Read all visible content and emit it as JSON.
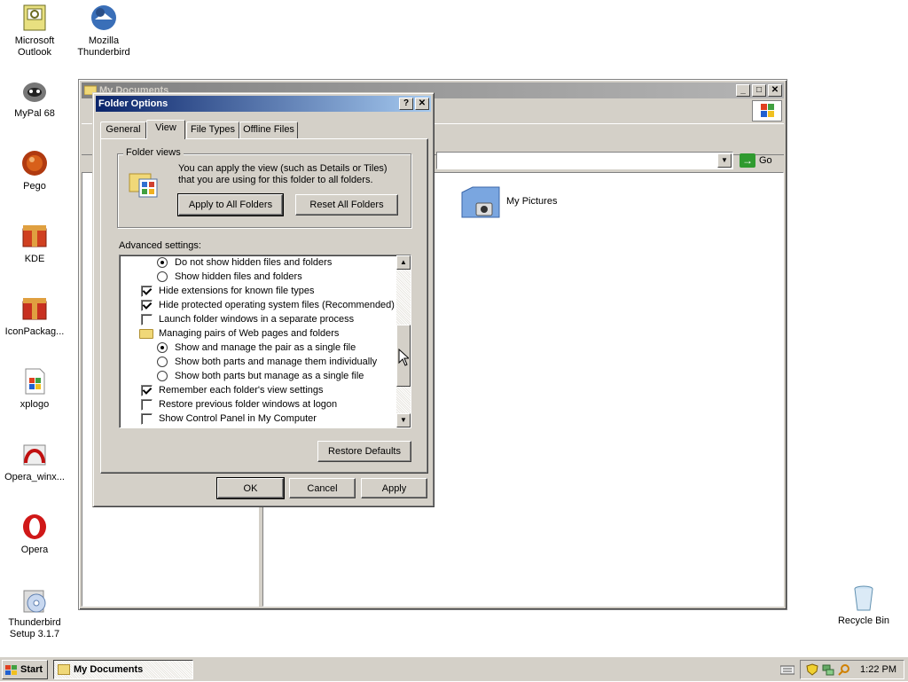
{
  "desktop": {
    "icons": [
      {
        "label": "Microsoft Outlook",
        "line1": "Microsoft",
        "line2": "Outlook",
        "icon": "outlook-icon"
      },
      {
        "label": "Mozilla Thunderbird",
        "line1": "Mozilla",
        "line2": "Thunderbird",
        "icon": "thunderbird-icon"
      },
      {
        "label": "MyPal 68",
        "icon": "mypal-icon"
      },
      {
        "label": "Pego",
        "icon": "pego-icon"
      },
      {
        "label": "KDE",
        "icon": "kde-icon"
      },
      {
        "label": "IconPackag...",
        "icon": "iconpackager-icon"
      },
      {
        "label": "xplogo",
        "icon": "xplogo-icon"
      },
      {
        "label": "Opera_winx...",
        "icon": "opera-installer-icon"
      },
      {
        "label": "Opera",
        "icon": "opera-icon"
      },
      {
        "label": "Thunderbird Setup 3.1.7",
        "line1": "Thunderbird",
        "line2": "Setup 3.1.7",
        "icon": "thunderbird-setup-icon"
      },
      {
        "label": "Recycle Bin",
        "icon": "recycle-bin-icon"
      }
    ]
  },
  "explorer": {
    "title": "My Documents",
    "go_label": "Go",
    "right_pane": {
      "item_label": "My Pictures"
    }
  },
  "dialog": {
    "title": "Folder Options",
    "help_glyph": "?",
    "close_glyph": "✕",
    "tabs": [
      "General",
      "View",
      "File Types",
      "Offline Files"
    ],
    "active_tab": "View",
    "folder_views": {
      "title": "Folder views",
      "text": "You can apply the view (such as Details or Tiles) that you are using for this folder to all folders.",
      "apply_all_label": "Apply to All Folders",
      "reset_all_label": "Reset All Folders"
    },
    "advanced_label": "Advanced settings:",
    "advanced_items": [
      {
        "type": "radio",
        "checked": true,
        "indent": 1,
        "label": "Do not show hidden files and folders"
      },
      {
        "type": "radio",
        "checked": false,
        "indent": 1,
        "label": "Show hidden files and folders"
      },
      {
        "type": "checkbox",
        "checked": true,
        "indent": 0,
        "label": "Hide extensions for known file types"
      },
      {
        "type": "checkbox",
        "checked": true,
        "indent": 0,
        "label": "Hide protected operating system files (Recommended)"
      },
      {
        "type": "checkbox",
        "checked": false,
        "indent": 0,
        "label": "Launch folder windows in a separate process"
      },
      {
        "type": "folder",
        "checked": false,
        "indent": 0,
        "label": "Managing pairs of Web pages and folders"
      },
      {
        "type": "radio",
        "checked": true,
        "indent": 1,
        "label": "Show and manage the pair as a single file"
      },
      {
        "type": "radio",
        "checked": false,
        "indent": 1,
        "label": "Show both parts and manage them individually"
      },
      {
        "type": "radio",
        "checked": false,
        "indent": 1,
        "label": "Show both parts but manage as a single file"
      },
      {
        "type": "checkbox",
        "checked": true,
        "indent": 0,
        "label": "Remember each folder's view settings"
      },
      {
        "type": "checkbox",
        "checked": false,
        "indent": 0,
        "label": "Restore previous folder windows at logon"
      },
      {
        "type": "checkbox",
        "checked": false,
        "indent": 0,
        "label": "Show Control Panel in My Computer"
      }
    ],
    "restore_defaults_label": "Restore Defaults",
    "ok_label": "OK",
    "cancel_label": "Cancel",
    "apply_label": "Apply"
  },
  "taskbar": {
    "start_label": "Start",
    "task_label": "My Documents",
    "clock": "1:22 PM"
  }
}
